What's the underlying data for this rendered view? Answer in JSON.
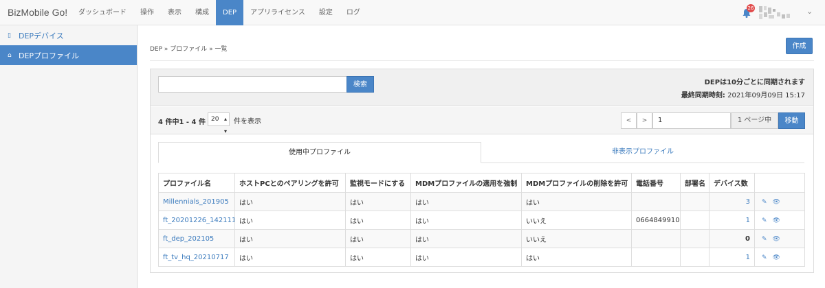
{
  "navbar": {
    "brand": "BizMobile Go!",
    "items": [
      {
        "label": "ダッシュボード",
        "active": false
      },
      {
        "label": "操作",
        "active": false
      },
      {
        "label": "表示",
        "active": false
      },
      {
        "label": "構成",
        "active": false
      },
      {
        "label": "DEP",
        "active": true
      },
      {
        "label": "アプリライセンス",
        "active": false
      },
      {
        "label": "設定",
        "active": false
      },
      {
        "label": "ログ",
        "active": false
      }
    ],
    "notification_count": "26"
  },
  "sidebar": {
    "items": [
      {
        "label": "DEPデバイス",
        "icon": "mobile-icon",
        "active": false
      },
      {
        "label": "DEPプロファイル",
        "icon": "inbox-icon",
        "active": true
      }
    ]
  },
  "main": {
    "breadcrumb": "DEP » プロファイル » 一覧",
    "create_label": "作成",
    "search": {
      "value": "",
      "button_label": "検索"
    },
    "sync_note": "DEPは10分ごとに同期されます",
    "last_sync_label": "最終同期時刻:",
    "last_sync_value": "2021年09月09日 15:17",
    "count_text": "4 件中1 - 4 件",
    "per_page": "20",
    "per_page_label": "件を表示",
    "pager": {
      "prev": "<",
      "next": ">",
      "page": "1",
      "page_label": "1 ページ中",
      "go_label": "移動"
    },
    "tabs": [
      {
        "label": "使用中プロファイル",
        "active": true
      },
      {
        "label": "非表示プロファイル",
        "active": false
      }
    ],
    "table": {
      "headers": [
        "プロファイル名",
        "ホストPCとのペアリングを許可",
        "監視モードにする",
        "MDMプロファイルの適用を強制",
        "MDMプロファイルの削除を許可",
        "電話番号",
        "部署名",
        "デバイス数",
        ""
      ],
      "rows": [
        {
          "name": "Millennials_201905",
          "pairing": "はい",
          "supervised": "はい",
          "mdm_force": "はい",
          "mdm_remove": "はい",
          "phone": "",
          "dept": "",
          "devices": "3"
        },
        {
          "name": "ft_20201226_142111",
          "pairing": "はい",
          "supervised": "はい",
          "mdm_force": "はい",
          "mdm_remove": "いいえ",
          "phone": "0664849910",
          "dept": "",
          "devices": "1"
        },
        {
          "name": "ft_dep_202105",
          "pairing": "はい",
          "supervised": "はい",
          "mdm_force": "はい",
          "mdm_remove": "いいえ",
          "phone": "",
          "dept": "",
          "devices": "0"
        },
        {
          "name": "ft_tv_hq_20210717",
          "pairing": "はい",
          "supervised": "はい",
          "mdm_force": "はい",
          "mdm_remove": "はい",
          "phone": "",
          "dept": "",
          "devices": "1"
        }
      ]
    }
  },
  "colors": {
    "accent": "#4a86c8",
    "link": "#3a7abd",
    "badge": "#e14c4c"
  }
}
